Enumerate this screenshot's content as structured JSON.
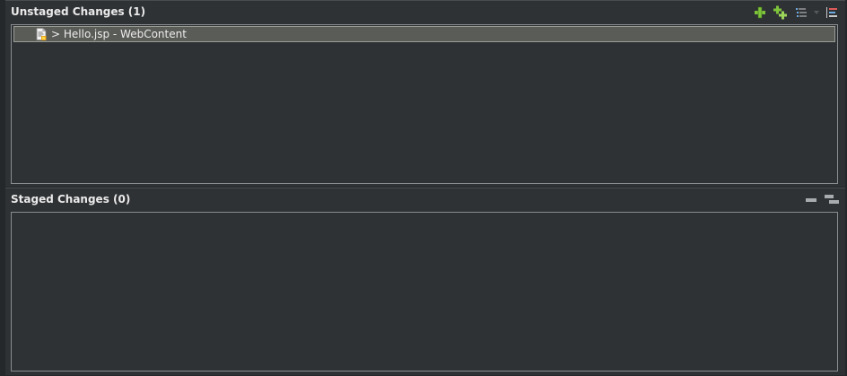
{
  "unstaged": {
    "title": "Unstaged Changes (1)",
    "toolbar": [
      {
        "icon": "add-icon"
      },
      {
        "icon": "add-all-icon"
      },
      {
        "icon": "list-presentation-icon"
      },
      {
        "icon": "view-menu-icon"
      },
      {
        "icon": "sort-icon"
      }
    ],
    "items": [
      {
        "label": "> Hello.jsp - WebContent",
        "icon": "jsp-file-icon"
      }
    ]
  },
  "staged": {
    "title": "Staged Changes (0)",
    "toolbar": [
      {
        "icon": "remove-icon"
      },
      {
        "icon": "remove-all-icon"
      }
    ],
    "items": []
  },
  "colors": {
    "background": "#2f3235",
    "selection": "#5a5c58",
    "accent_green": "#7ec43b"
  }
}
